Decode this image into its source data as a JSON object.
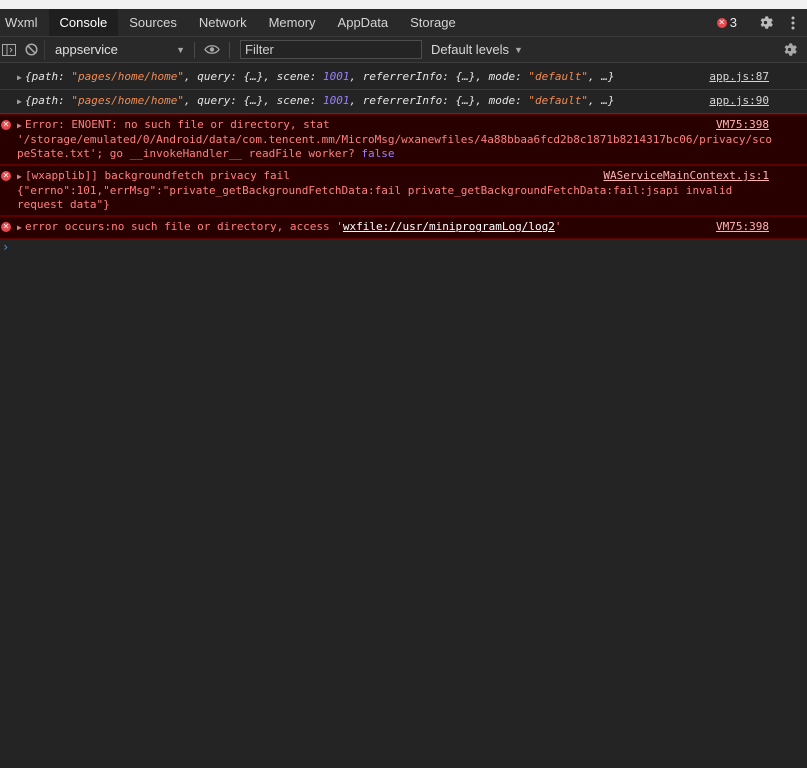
{
  "tabs": [
    {
      "label": "Wxml"
    },
    {
      "label": "Console"
    },
    {
      "label": "Sources"
    },
    {
      "label": "Network"
    },
    {
      "label": "Memory"
    },
    {
      "label": "AppData"
    },
    {
      "label": "Storage"
    }
  ],
  "header": {
    "error_count": "3"
  },
  "toolbar": {
    "context": "appservice",
    "filter_placeholder": "Filter",
    "levels_label": "Default levels"
  },
  "messages": {
    "log1": {
      "pre": "{path: ",
      "path": "\"pages/home/home\"",
      "mid1": ", query: {…}, scene: ",
      "scene": "1001",
      "mid2": ", referrerInfo: {…}, mode: ",
      "mode": "\"default\"",
      "end": ", …}",
      "source": "app.js:87"
    },
    "log2": {
      "pre": "{path: ",
      "path": "\"pages/home/home\"",
      "mid1": ", query: {…}, scene: ",
      "scene": "1001",
      "mid2": ", referrerInfo: {…}, mode: ",
      "mode": "\"default\"",
      "end": ", …}",
      "source": "app.js:90"
    },
    "err1": {
      "line1": "Error: ENOENT: no such file or directory, stat",
      "line2": "'/storage/emulated/0/Android/data/com.tencent.mm/MicroMsg/wxanewfiles/4a88bbaa6fcd2b8c1871b8214317bc06/privacy/sco",
      "line3a": "peState.txt'; go __invokeHandler__ readFile worker? ",
      "line3b": "false",
      "source": "VM75:398"
    },
    "err2": {
      "line1": "[wxapplib]] backgroundfetch privacy fail",
      "line2": "{\"errno\":101,\"errMsg\":\"private_getBackgroundFetchData:fail private_getBackgroundFetchData:fail:jsapi invalid",
      "line3": "request data\"}",
      "source": "WAServiceMainContext.js:1"
    },
    "err3": {
      "pre": "error occurs:no such file or directory, access '",
      "link": "wxfile://usr/miniprogramLog/log2",
      "post": "'",
      "source": "VM75:398"
    }
  },
  "prompt_symbol": "›",
  "icons": {
    "error": "error-circle-icon",
    "settings": "gear-icon",
    "more": "kebab-menu-icon",
    "sidebar": "sidebar-toggle-icon",
    "clear": "clear-console-icon",
    "eye": "live-expression-icon"
  },
  "colors": {
    "error_bg": "#290000",
    "error_text": "#ff8080",
    "string": "#f28b54",
    "number": "#9980ff"
  }
}
